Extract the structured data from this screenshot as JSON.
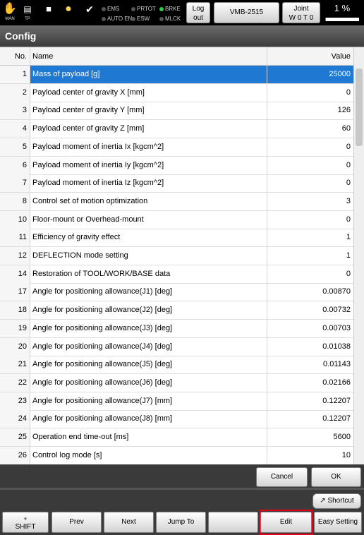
{
  "status": {
    "man_label": "MAN",
    "tp_label": "TP",
    "emg": "EMS",
    "auto_en": "AUTO EN",
    "prtot": "PRTOT",
    "esw": "ESW",
    "brke": "BRKE",
    "mlck": "MLCK",
    "logout_line1": "Log",
    "logout_line2": "out",
    "robot_model": "VMB-2515",
    "joint_line1": "Joint",
    "joint_line2": "W 0 T 0",
    "speed": "1 %",
    "speed_fraction": 0.01
  },
  "title": "Config",
  "table": {
    "header": {
      "no": "No.",
      "name": "Name",
      "value": "Value"
    },
    "rows": [
      {
        "no": "1",
        "name": "Mass of payload [g]",
        "value": "25000"
      },
      {
        "no": "2",
        "name": "Payload center of gravity X [mm]",
        "value": "0"
      },
      {
        "no": "3",
        "name": "Payload center of gravity Y [mm]",
        "value": "126"
      },
      {
        "no": "4",
        "name": "Payload center of gravity Z [mm]",
        "value": "60"
      },
      {
        "no": "5",
        "name": "Payload moment of inertia Ix [kgcm^2]",
        "value": "0"
      },
      {
        "no": "6",
        "name": "Payload moment of inertia Iy [kgcm^2]",
        "value": "0"
      },
      {
        "no": "7",
        "name": "Payload moment of inertia Iz [kgcm^2]",
        "value": "0"
      },
      {
        "no": "8",
        "name": "Control set of motion optimization",
        "value": "3"
      },
      {
        "no": "10",
        "name": "Floor-mount or Overhead-mount",
        "value": "0"
      },
      {
        "no": "11",
        "name": "Efficiency of gravity effect",
        "value": "1"
      },
      {
        "no": "12",
        "name": "DEFLECTION mode setting",
        "value": "1"
      },
      {
        "no": "14",
        "name": "Restoration of TOOL/WORK/BASE data",
        "value": "0"
      },
      {
        "no": "17",
        "name": "Angle for positioning allowance(J1) [deg]",
        "value": "0.00870"
      },
      {
        "no": "18",
        "name": "Angle for positioning allowance(J2) [deg]",
        "value": "0.00732"
      },
      {
        "no": "19",
        "name": "Angle for positioning allowance(J3) [deg]",
        "value": "0.00703"
      },
      {
        "no": "20",
        "name": "Angle for positioning allowance(J4) [deg]",
        "value": "0.01038"
      },
      {
        "no": "21",
        "name": "Angle for positioning allowance(J5) [deg]",
        "value": "0.01143"
      },
      {
        "no": "22",
        "name": "Angle for positioning allowance(J6) [deg]",
        "value": "0.02166"
      },
      {
        "no": "23",
        "name": "Angle for positioning allowance(J7) [mm]",
        "value": "0.12207"
      },
      {
        "no": "24",
        "name": "Angle for positioning allowance(J8) [mm]",
        "value": "0.12207"
      },
      {
        "no": "25",
        "name": "Operation end time-out  [ms]",
        "value": "5600"
      },
      {
        "no": "26",
        "name": "Control log mode [s]",
        "value": "10"
      }
    ]
  },
  "actions": {
    "cancel": "Cancel",
    "ok": "OK",
    "shortcut": "Shortcut"
  },
  "fkeys": {
    "shift": "SHIFT",
    "prev": "Prev",
    "next": "Next",
    "jump_to": "Jump To",
    "blank": "",
    "edit": "Edit",
    "easy_setting": "Easy Setting"
  },
  "colors": {
    "selection": "#1f78d1",
    "highlight": "#e3001b",
    "indicator_on": "#2ecc40"
  }
}
